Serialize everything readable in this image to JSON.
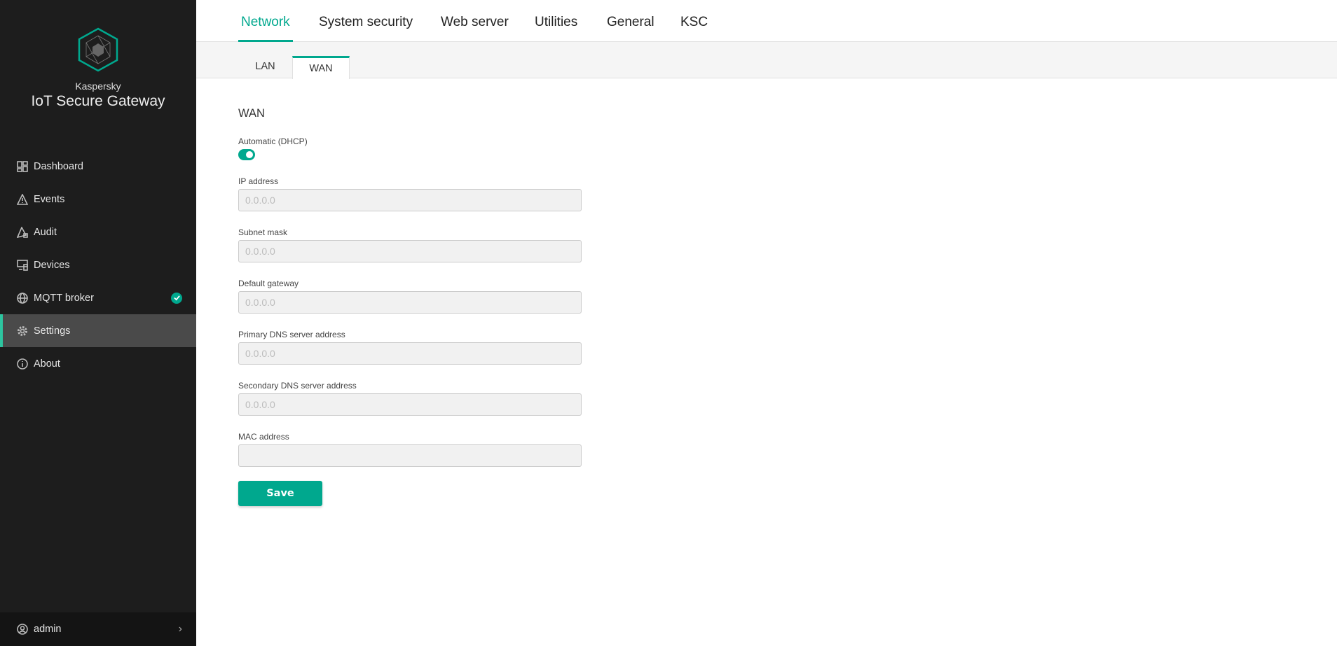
{
  "brand": {
    "company": "Kaspersky",
    "product": "IoT Secure Gateway"
  },
  "sidebar": {
    "items": [
      {
        "label": "Dashboard",
        "icon": "dashboard-icon"
      },
      {
        "label": "Events",
        "icon": "warning-icon"
      },
      {
        "label": "Audit",
        "icon": "audit-icon"
      },
      {
        "label": "Devices",
        "icon": "devices-icon"
      },
      {
        "label": "MQTT broker",
        "icon": "globe-icon",
        "status": "ok"
      },
      {
        "label": "Settings",
        "icon": "gear-icon",
        "active": true
      },
      {
        "label": "About",
        "icon": "info-icon"
      }
    ],
    "user": "admin"
  },
  "tabs": [
    "Network",
    "System security",
    "Web server",
    "Utilities",
    "General",
    "KSC"
  ],
  "subtabs": [
    "LAN",
    "WAN"
  ],
  "form": {
    "title": "WAN",
    "dhcp_label": "Automatic (DHCP)",
    "dhcp_on": true,
    "fields": [
      {
        "label": "IP address",
        "placeholder": "0.0.0.0"
      },
      {
        "label": "Subnet mask",
        "placeholder": "0.0.0.0"
      },
      {
        "label": "Default gateway",
        "placeholder": "0.0.0.0"
      },
      {
        "label": "Primary DNS server address",
        "placeholder": "0.0.0.0"
      },
      {
        "label": "Secondary DNS server address",
        "placeholder": "0.0.0.0"
      },
      {
        "label": "MAC address",
        "placeholder": ""
      }
    ],
    "save": "Save"
  },
  "colors": {
    "accent": "#00a88e",
    "sidebar": "#1d1d1d"
  }
}
